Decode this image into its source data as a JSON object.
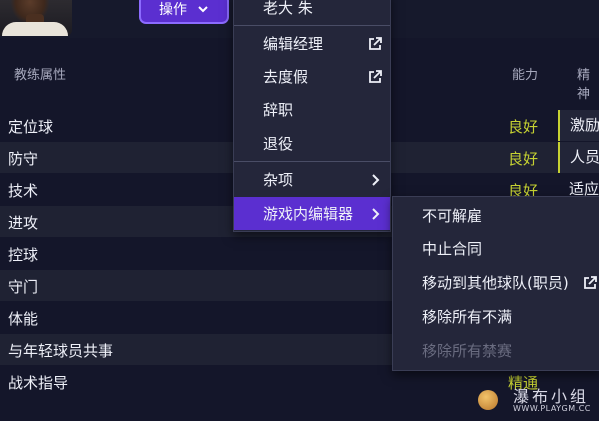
{
  "header": {
    "actions_label": "操作",
    "partial_top_item": "老大 朱"
  },
  "columns": {
    "coach_attributes": "教练属性",
    "ability": "能力",
    "mental": "精神"
  },
  "attributes": [
    {
      "name": "定位球",
      "value": "良好"
    },
    {
      "name": "防守",
      "value": "良好"
    },
    {
      "name": "技术",
      "value": "良好"
    },
    {
      "name": "进攻",
      "value": ""
    },
    {
      "name": "控球",
      "value": ""
    },
    {
      "name": "守门",
      "value": ""
    },
    {
      "name": "体能",
      "value": ""
    },
    {
      "name": "与年轻球员共事",
      "value": ""
    },
    {
      "name": "战术指导",
      "value": "精通"
    }
  ],
  "mental_column": [
    "激励",
    "人员",
    "适应"
  ],
  "context_menu": {
    "items": [
      {
        "label": "编辑经理",
        "icon": "external-link-icon"
      },
      {
        "label": "去度假",
        "icon": "external-link-icon"
      },
      {
        "label": "辞职",
        "icon": ""
      },
      {
        "label": "退役",
        "icon": ""
      },
      {
        "label": "杂项",
        "icon": "chevron-right-icon"
      },
      {
        "label": "游戏内编辑器",
        "icon": "chevron-right-icon",
        "selected": true
      }
    ]
  },
  "submenu": {
    "items": [
      {
        "label": "不可解雇",
        "disabled": false
      },
      {
        "label": "中止合同",
        "disabled": false
      },
      {
        "label": "移动到其他球队(职员)",
        "icon": "external-link-icon",
        "disabled": false
      },
      {
        "label": "移除所有不满",
        "disabled": false
      },
      {
        "label": "移除所有禁赛",
        "disabled": true
      }
    ]
  },
  "watermark": {
    "name": "瀑布小组",
    "url": "WWW.PLAYGM.CC"
  },
  "colors": {
    "accent": "#5b2fd0",
    "value_good": "#c6d232",
    "background": "#14162a"
  }
}
